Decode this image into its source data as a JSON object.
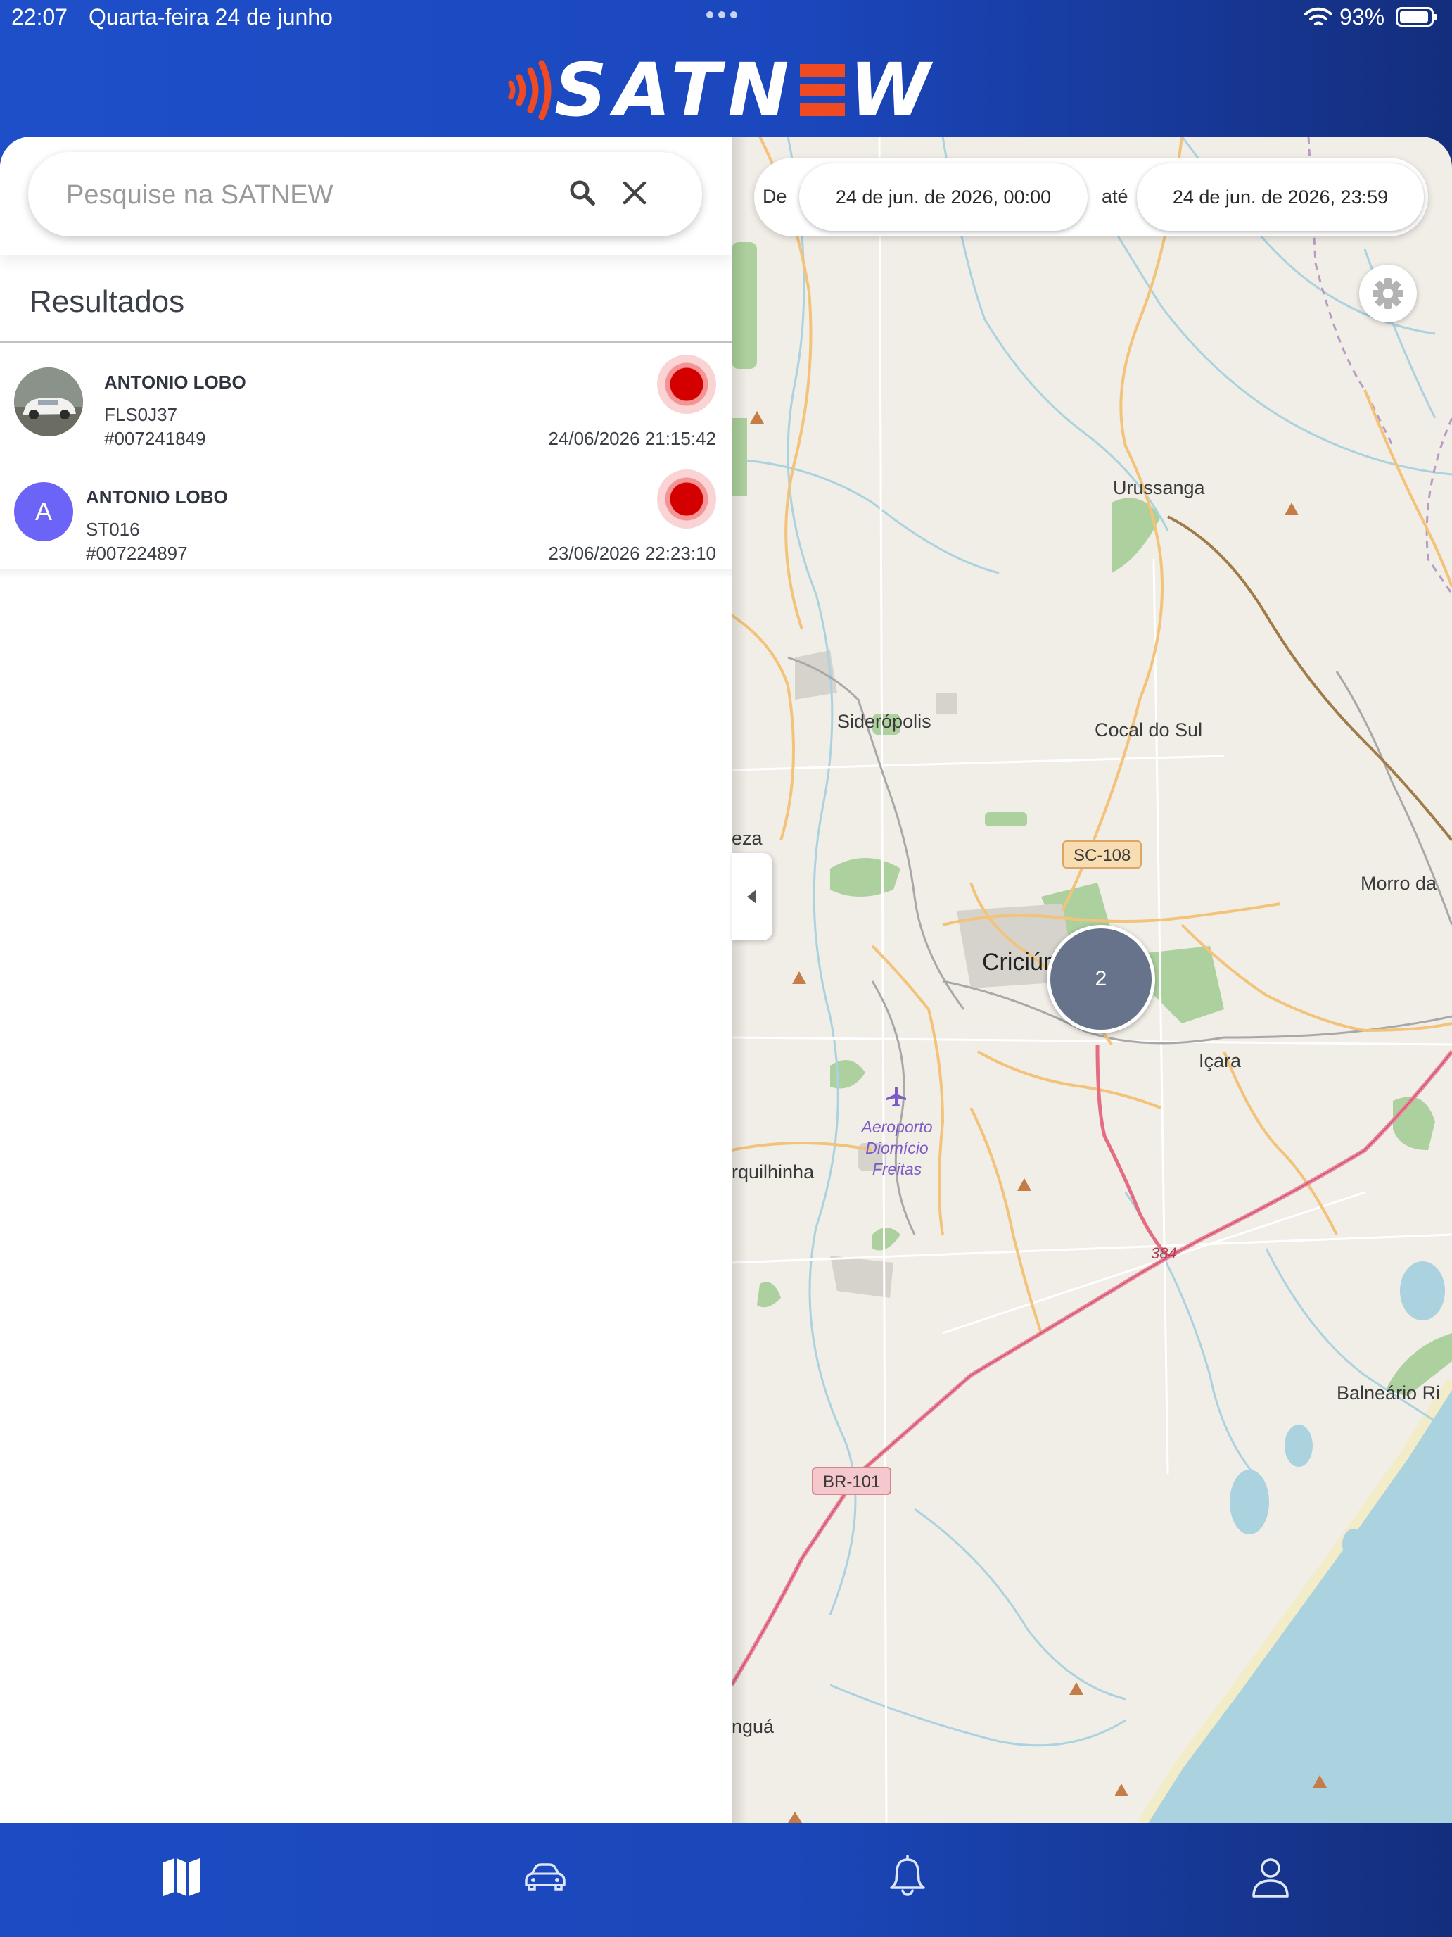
{
  "status_bar": {
    "time": "22:07",
    "date": "Quarta-feira 24 de junho",
    "battery": "93%"
  },
  "header": {
    "logo_text_left": "SATN",
    "logo_text_right": "W",
    "brand_color": "#1e4fc9",
    "accent_color": "#f04a23"
  },
  "search": {
    "placeholder": "Pesquise na SATNEW",
    "value": ""
  },
  "results": {
    "title": "Resultados",
    "items": [
      {
        "name": "ANTONIO LOBO",
        "plate": "FLS0J37",
        "id": "#007241849",
        "timestamp": "24/06/2026 21:15:42",
        "avatar": "car-photo",
        "status_color": "#d40000"
      },
      {
        "name": "ANTONIO LOBO",
        "plate": "ST016",
        "id": "#007224897",
        "timestamp": "23/06/2026 22:23:10",
        "avatar_letter": "A",
        "avatar_color": "#6c63f7",
        "status_color": "#d40000"
      }
    ]
  },
  "date_filter": {
    "from_label": "De",
    "from_value": "24 de jun. de 2026, 00:00",
    "to_label": "até",
    "to_value": "24 de jun. de 2026, 23:59"
  },
  "map": {
    "cluster_count": "2",
    "places": {
      "urussanga": "Urussanga",
      "sideropolis": "Siderópolis",
      "cocal": "Cocal do Sul",
      "criciuma": "Criciúma",
      "icara": "Içara",
      "morro": "Morro da",
      "balneario": "Balneário Ri",
      "forquilhinha": "rquilhinha",
      "nova_veneza": "eza",
      "ararangua": "nguá",
      "airport_l1": "Aeroporto",
      "airport_l2": "Diomício",
      "airport_l3": "Freitas"
    },
    "roads": {
      "sc108": "SC-108",
      "br101": "BR-101",
      "r384": "384"
    }
  },
  "bottom_nav": {
    "items": [
      "map-icon",
      "car-icon",
      "bell-icon",
      "user-icon"
    ]
  }
}
